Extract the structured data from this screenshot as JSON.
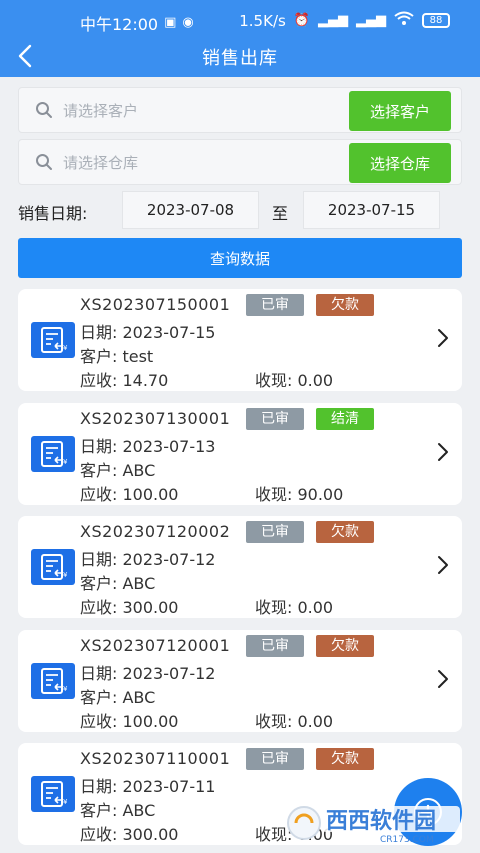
{
  "status_bar": {
    "time": "中午12:00",
    "speed": "1.5K/s",
    "battery": "88"
  },
  "header": {
    "title": "销售出库"
  },
  "customer": {
    "placeholder": "请选择客户",
    "button": "选择客户"
  },
  "warehouse": {
    "placeholder": "请选择仓库",
    "button": "选择仓库"
  },
  "date_filter": {
    "label": "销售日期:",
    "start": "2023-07-08",
    "to": "至",
    "end": "2023-07-15"
  },
  "query_button": "查询数据",
  "colors": {
    "primary": "#3a8ff0",
    "query": "#1e88f5",
    "green": "#52c22d",
    "audit": "#8e9aa4",
    "owed": "#b8643f",
    "settled": "#52c22d"
  },
  "orders": [
    {
      "no": "XS202307150001",
      "audit": "已审",
      "state": "欠款",
      "state_color": "#b8643f",
      "date": "日期: 2023-07-15",
      "customer": "客户: test",
      "receivable": "应收: 14.70",
      "cash": "收现: 0.00"
    },
    {
      "no": "XS202307130001",
      "audit": "已审",
      "state": "结清",
      "state_color": "#52c22d",
      "date": "日期: 2023-07-13",
      "customer": "客户: ABC",
      "receivable": "应收: 100.00",
      "cash": "收现: 90.00"
    },
    {
      "no": "XS202307120002",
      "audit": "已审",
      "state": "欠款",
      "state_color": "#b8643f",
      "date": "日期: 2023-07-12",
      "customer": "客户: ABC",
      "receivable": "应收: 300.00",
      "cash": "收现: 0.00"
    },
    {
      "no": "XS202307120001",
      "audit": "已审",
      "state": "欠款",
      "state_color": "#b8643f",
      "date": "日期: 2023-07-12",
      "customer": "客户: ABC",
      "receivable": "应收: 100.00",
      "cash": "收现: 0.00"
    },
    {
      "no": "XS202307110001",
      "audit": "已审",
      "state": "欠款",
      "state_color": "#b8643f",
      "date": "日期: 2023-07-11",
      "customer": "客户: ABC",
      "receivable": "应收: 300.00",
      "cash": "收现: 0.00"
    }
  ],
  "watermark": {
    "text": "西西软件园",
    "site": "CR173.COM"
  }
}
